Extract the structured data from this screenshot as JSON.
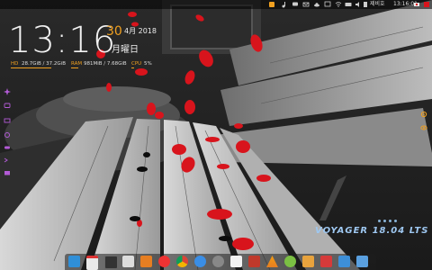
{
  "top_panel": {
    "user_name": "제비호",
    "time": "13:16:01",
    "icons": [
      "app-icon",
      "music-icon",
      "chat-icon",
      "mail-icon",
      "cloud-icon",
      "network-icon",
      "wifi-icon",
      "keyboard-icon",
      "volume-icon",
      "battery-icon",
      "bluetooth-icon",
      "flag-icon",
      "power-icon"
    ]
  },
  "clock": {
    "time": "13:16",
    "day": "30",
    "month_year": "4月 2018",
    "weekday": "月曜日"
  },
  "system": {
    "hd_label": "HD",
    "hd_value": "28.7GiB / 37.2GiB",
    "hd_fraction": 0.77,
    "ram_label": "RAM",
    "ram_value": "981MiB / 7.68GiB",
    "ram_fraction": 0.13,
    "cpu_label": "CPU",
    "cpu_value": "5%",
    "cpu_fraction": 0.05
  },
  "left_rail": {
    "icons": [
      "airplane-icon",
      "chat-icon",
      "mail-icon",
      "settings-icon",
      "game-icon",
      "terminal-icon",
      "folder-icon"
    ]
  },
  "right_rail": {
    "icons": [
      "gear-icon",
      "eye-icon"
    ]
  },
  "branding": {
    "text": "VOYAGER 18.04 LTS"
  },
  "dock": {
    "icons": [
      "files-icon",
      "calendar-icon",
      "terminal-icon",
      "text-editor-icon",
      "photos-icon",
      "web-browser-icon",
      "chrome-icon",
      "mail-client-icon",
      "settings-icon",
      "documents-icon",
      "video-player-icon",
      "vlc-icon",
      "android-icon",
      "downloads-icon",
      "trash-icon",
      "folder-icon",
      "image-viewer-icon"
    ]
  },
  "colors": {
    "accent": "#f0a020",
    "brand": "#9ec7f0",
    "petal": "#d8141c"
  }
}
